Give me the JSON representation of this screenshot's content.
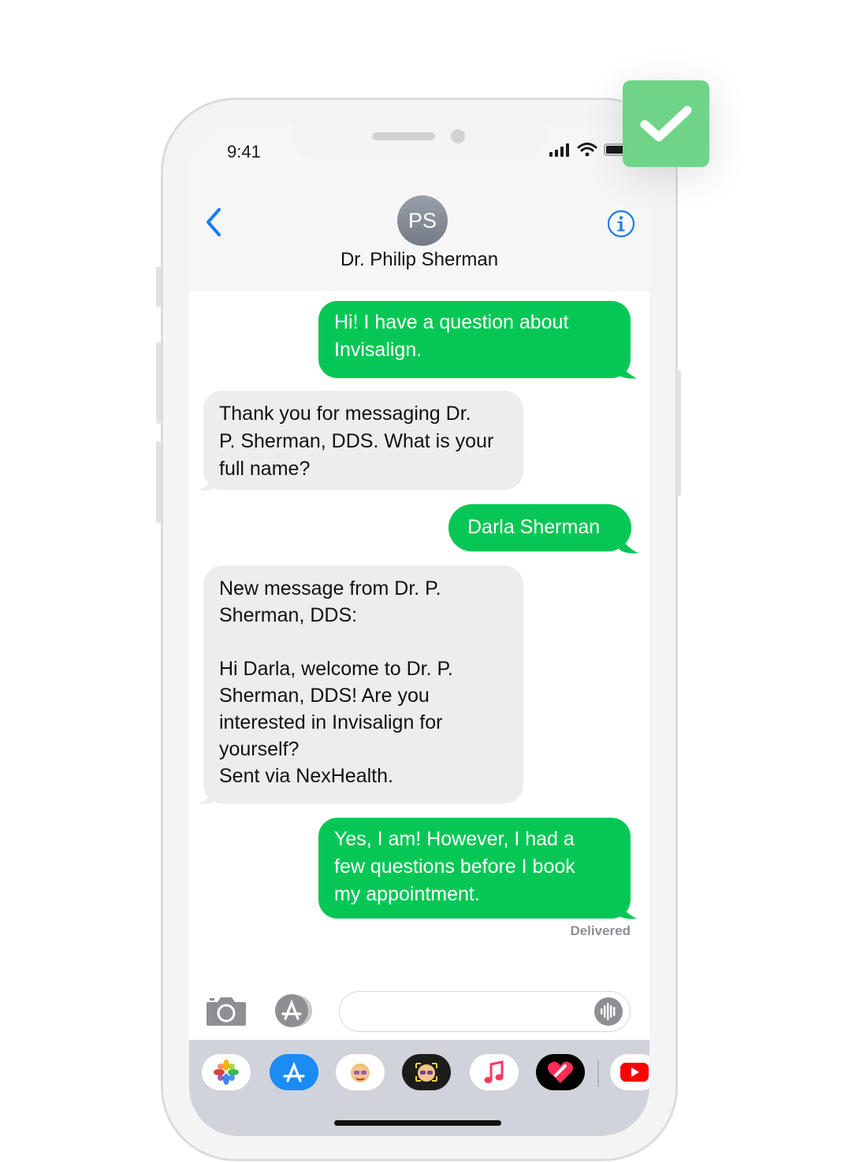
{
  "status_bar": {
    "time": "9:41"
  },
  "header": {
    "avatar_initials": "PS",
    "contact_name": "Dr. Philip Sherman",
    "back_icon": "chevron-left-icon",
    "info_icon": "info-icon"
  },
  "messages": [
    {
      "direction": "outgoing",
      "text": "Hi! I have a question about\nInvisalign."
    },
    {
      "direction": "incoming",
      "text": "Thank you for messaging Dr.\nP. Sherman, DDS. What is your\nfull name?"
    },
    {
      "direction": "outgoing",
      "text": "Darla Sherman"
    },
    {
      "direction": "incoming",
      "text": "New message from Dr. P.\nSherman, DDS:\n\nHi Darla, welcome to Dr. P.\nSherman, DDS! Are you\ninterested in Invisalign for\nyourself?\nSent via NexHealth."
    },
    {
      "direction": "outgoing",
      "text": "Yes, I am! However, I had a\nfew questions before I book\nmy appointment."
    }
  ],
  "delivery_status": "Delivered",
  "input_bar": {
    "camera_icon": "camera-icon",
    "apps_icon": "app-store-icon",
    "audio_icon": "audio-waveform-icon"
  },
  "dock_apps": [
    "photos-icon",
    "app-store-icon",
    "memoji-icon",
    "animoji-icon",
    "music-icon",
    "digital-touch-icon",
    "youtube-icon"
  ],
  "colors": {
    "outgoing_bubble": "#06c755",
    "incoming_bubble": "#ededed",
    "ios_blue": "#1a7cf0",
    "badge_green": "#70d488"
  },
  "badge_icon": "checkmark-icon"
}
